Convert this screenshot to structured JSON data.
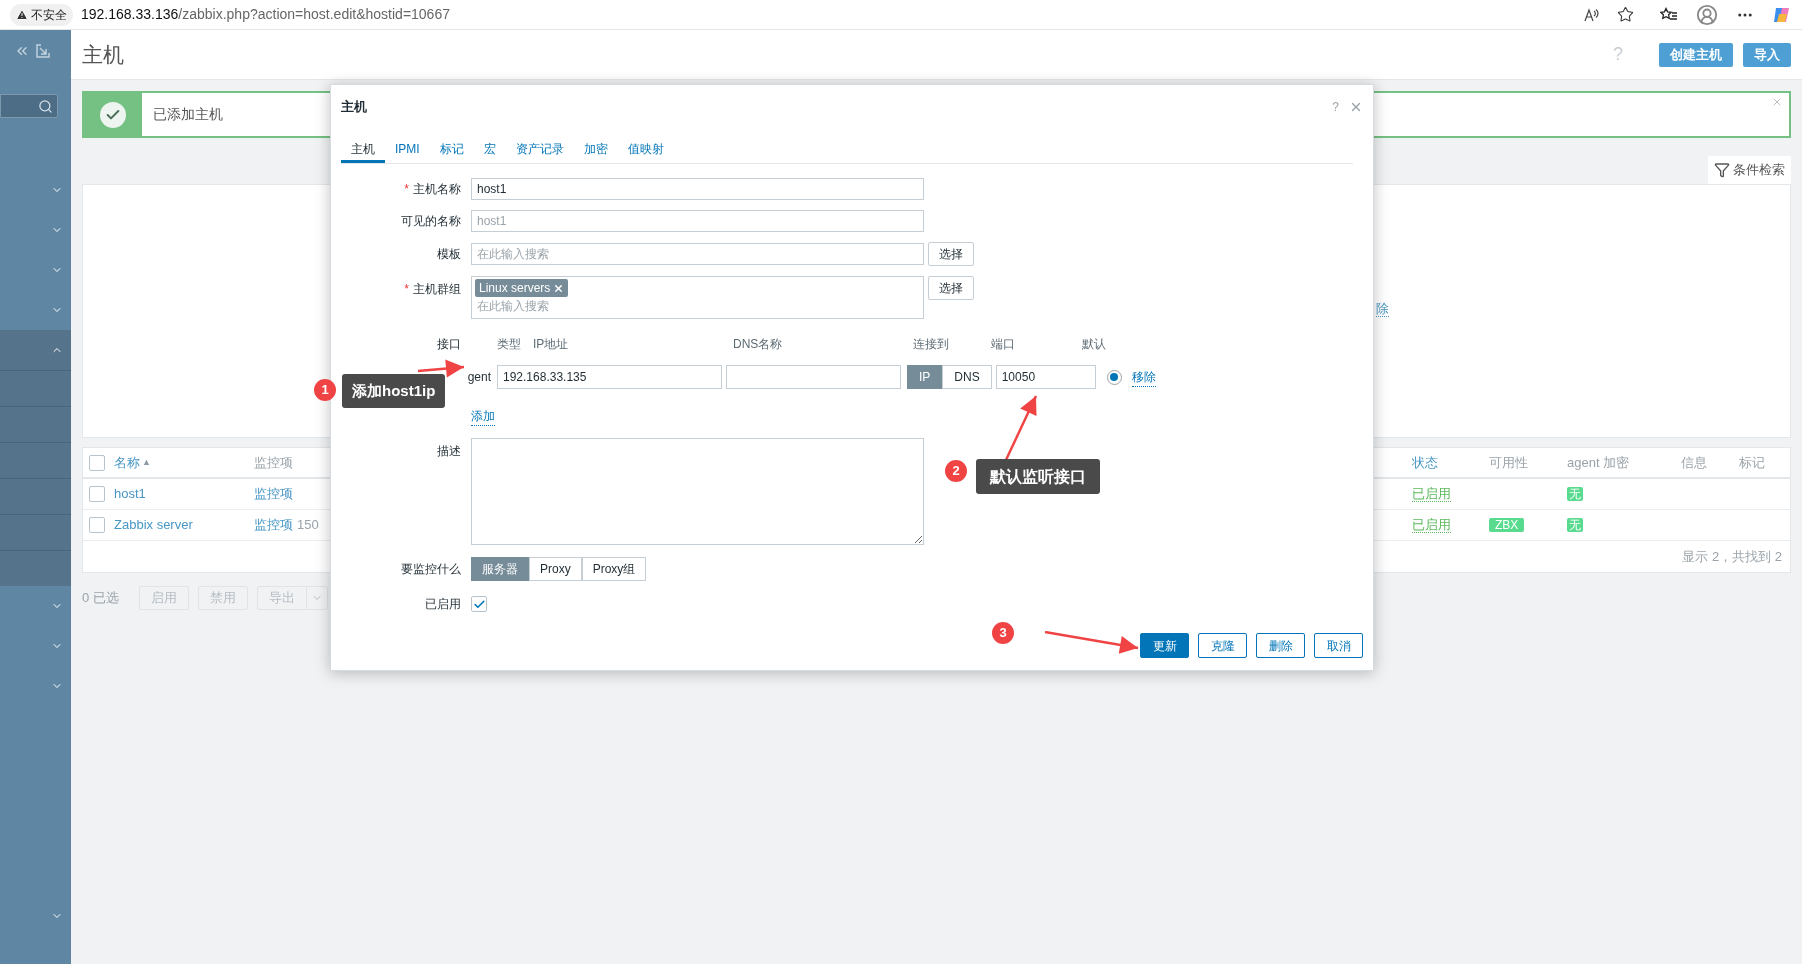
{
  "browser": {
    "security_label": "不安全",
    "url_host": "192.168.33.136",
    "url_path": "/zabbix.php?action=host.edit&hostid=10667"
  },
  "sidebar": {
    "menu": [
      {
        "expanded": false
      },
      {
        "expanded": false
      },
      {
        "expanded": false
      },
      {
        "expanded": false
      },
      {
        "expanded": true
      },
      {
        "expanded": false
      },
      {
        "expanded": false
      },
      {
        "expanded": false
      }
    ],
    "footer_menu": [
      {
        "expanded": false
      }
    ]
  },
  "page": {
    "title": "主机",
    "help": "?",
    "header_buttons": [
      "创建主机",
      "导入"
    ],
    "message": "已添加主机",
    "filter_tab": "条件检索",
    "filter_fragment": "除"
  },
  "table": {
    "select_all_checked": false,
    "sort_mark": "▲",
    "left_columns": [
      {
        "label": "名称",
        "sorted": true
      },
      {
        "label": "监控项",
        "sorted": false
      }
    ],
    "right_columns": [
      {
        "label": "状态",
        "sortable": true
      },
      {
        "label": "可用性",
        "sortable": false
      },
      {
        "label": "agent 加密",
        "sortable": false
      },
      {
        "label": "信息",
        "sortable": false
      },
      {
        "label": "标记",
        "sortable": false
      }
    ],
    "rows": [
      {
        "checked": false,
        "name": "host1",
        "items": "监控项",
        "status": "已启用",
        "encryption": "无"
      },
      {
        "checked": false,
        "name": "Zabbix server",
        "items": "监控项",
        "count": "150",
        "status": "已启用",
        "availability": "ZBX",
        "encryption": "无"
      }
    ],
    "footer": "显示 2，共找到 2"
  },
  "actions": {
    "selected": "0 已选",
    "buttons": [
      {
        "label": "启用",
        "kind": "plain",
        "disabled": true
      },
      {
        "label": "禁用",
        "kind": "plain",
        "disabled": true
      },
      {
        "label": "导出",
        "kind": "split",
        "disabled": true
      }
    ]
  },
  "dialog": {
    "title": "主机",
    "help": "?",
    "required_mark": "*",
    "tabs": [
      {
        "label": "主机",
        "selected": true
      },
      {
        "label": "IPMI",
        "selected": false
      },
      {
        "label": "标记",
        "selected": false
      },
      {
        "label": "宏",
        "selected": false
      },
      {
        "label": "资产记录",
        "selected": false
      },
      {
        "label": "加密",
        "selected": false
      },
      {
        "label": "值映射",
        "selected": false
      }
    ],
    "host_name": {
      "label": "主机名称",
      "required": true,
      "value": "host1"
    },
    "visible_name": {
      "label": "可见的名称",
      "required": false,
      "placeholder": "host1"
    },
    "templates": {
      "label": "模板",
      "required": false,
      "placeholder": "在此输入搜索",
      "button": "选择"
    },
    "host_groups": {
      "label": "主机群组",
      "required": true,
      "tags": [
        "Linux servers"
      ],
      "placeholder": "在此输入搜索",
      "button": "选择"
    },
    "interfaces": {
      "label": "接口",
      "columns": [
        "类型",
        "IP地址",
        "DNS名称",
        "连接到",
        "端口",
        "默认"
      ],
      "rows": [
        {
          "type": "gent",
          "ip": "192.168.33.135",
          "connect": [
            {
              "label": "IP",
              "selected": true
            },
            {
              "label": "DNS",
              "selected": false
            }
          ],
          "port": "10050",
          "default": true,
          "remove": "移除"
        }
      ],
      "add": "添加"
    },
    "description": {
      "label": "描述"
    },
    "monitored_by": {
      "label": "要监控什么",
      "options": [
        {
          "label": "服务器",
          "selected": true
        },
        {
          "label": "Proxy",
          "selected": false
        },
        {
          "label": "Proxy组",
          "selected": false
        }
      ]
    },
    "enabled": {
      "label": "已启用",
      "checked": true
    },
    "buttons": [
      {
        "label": "更新",
        "kind": "primary"
      },
      {
        "label": "克隆",
        "kind": "secondary"
      },
      {
        "label": "删除",
        "kind": "secondary"
      },
      {
        "label": "取消",
        "kind": "secondary"
      }
    ]
  },
  "annotations": [
    {
      "number": "1",
      "text": "添加host1ip"
    },
    {
      "number": "2",
      "text": "默认监听接口"
    },
    {
      "number": "3"
    }
  ]
}
